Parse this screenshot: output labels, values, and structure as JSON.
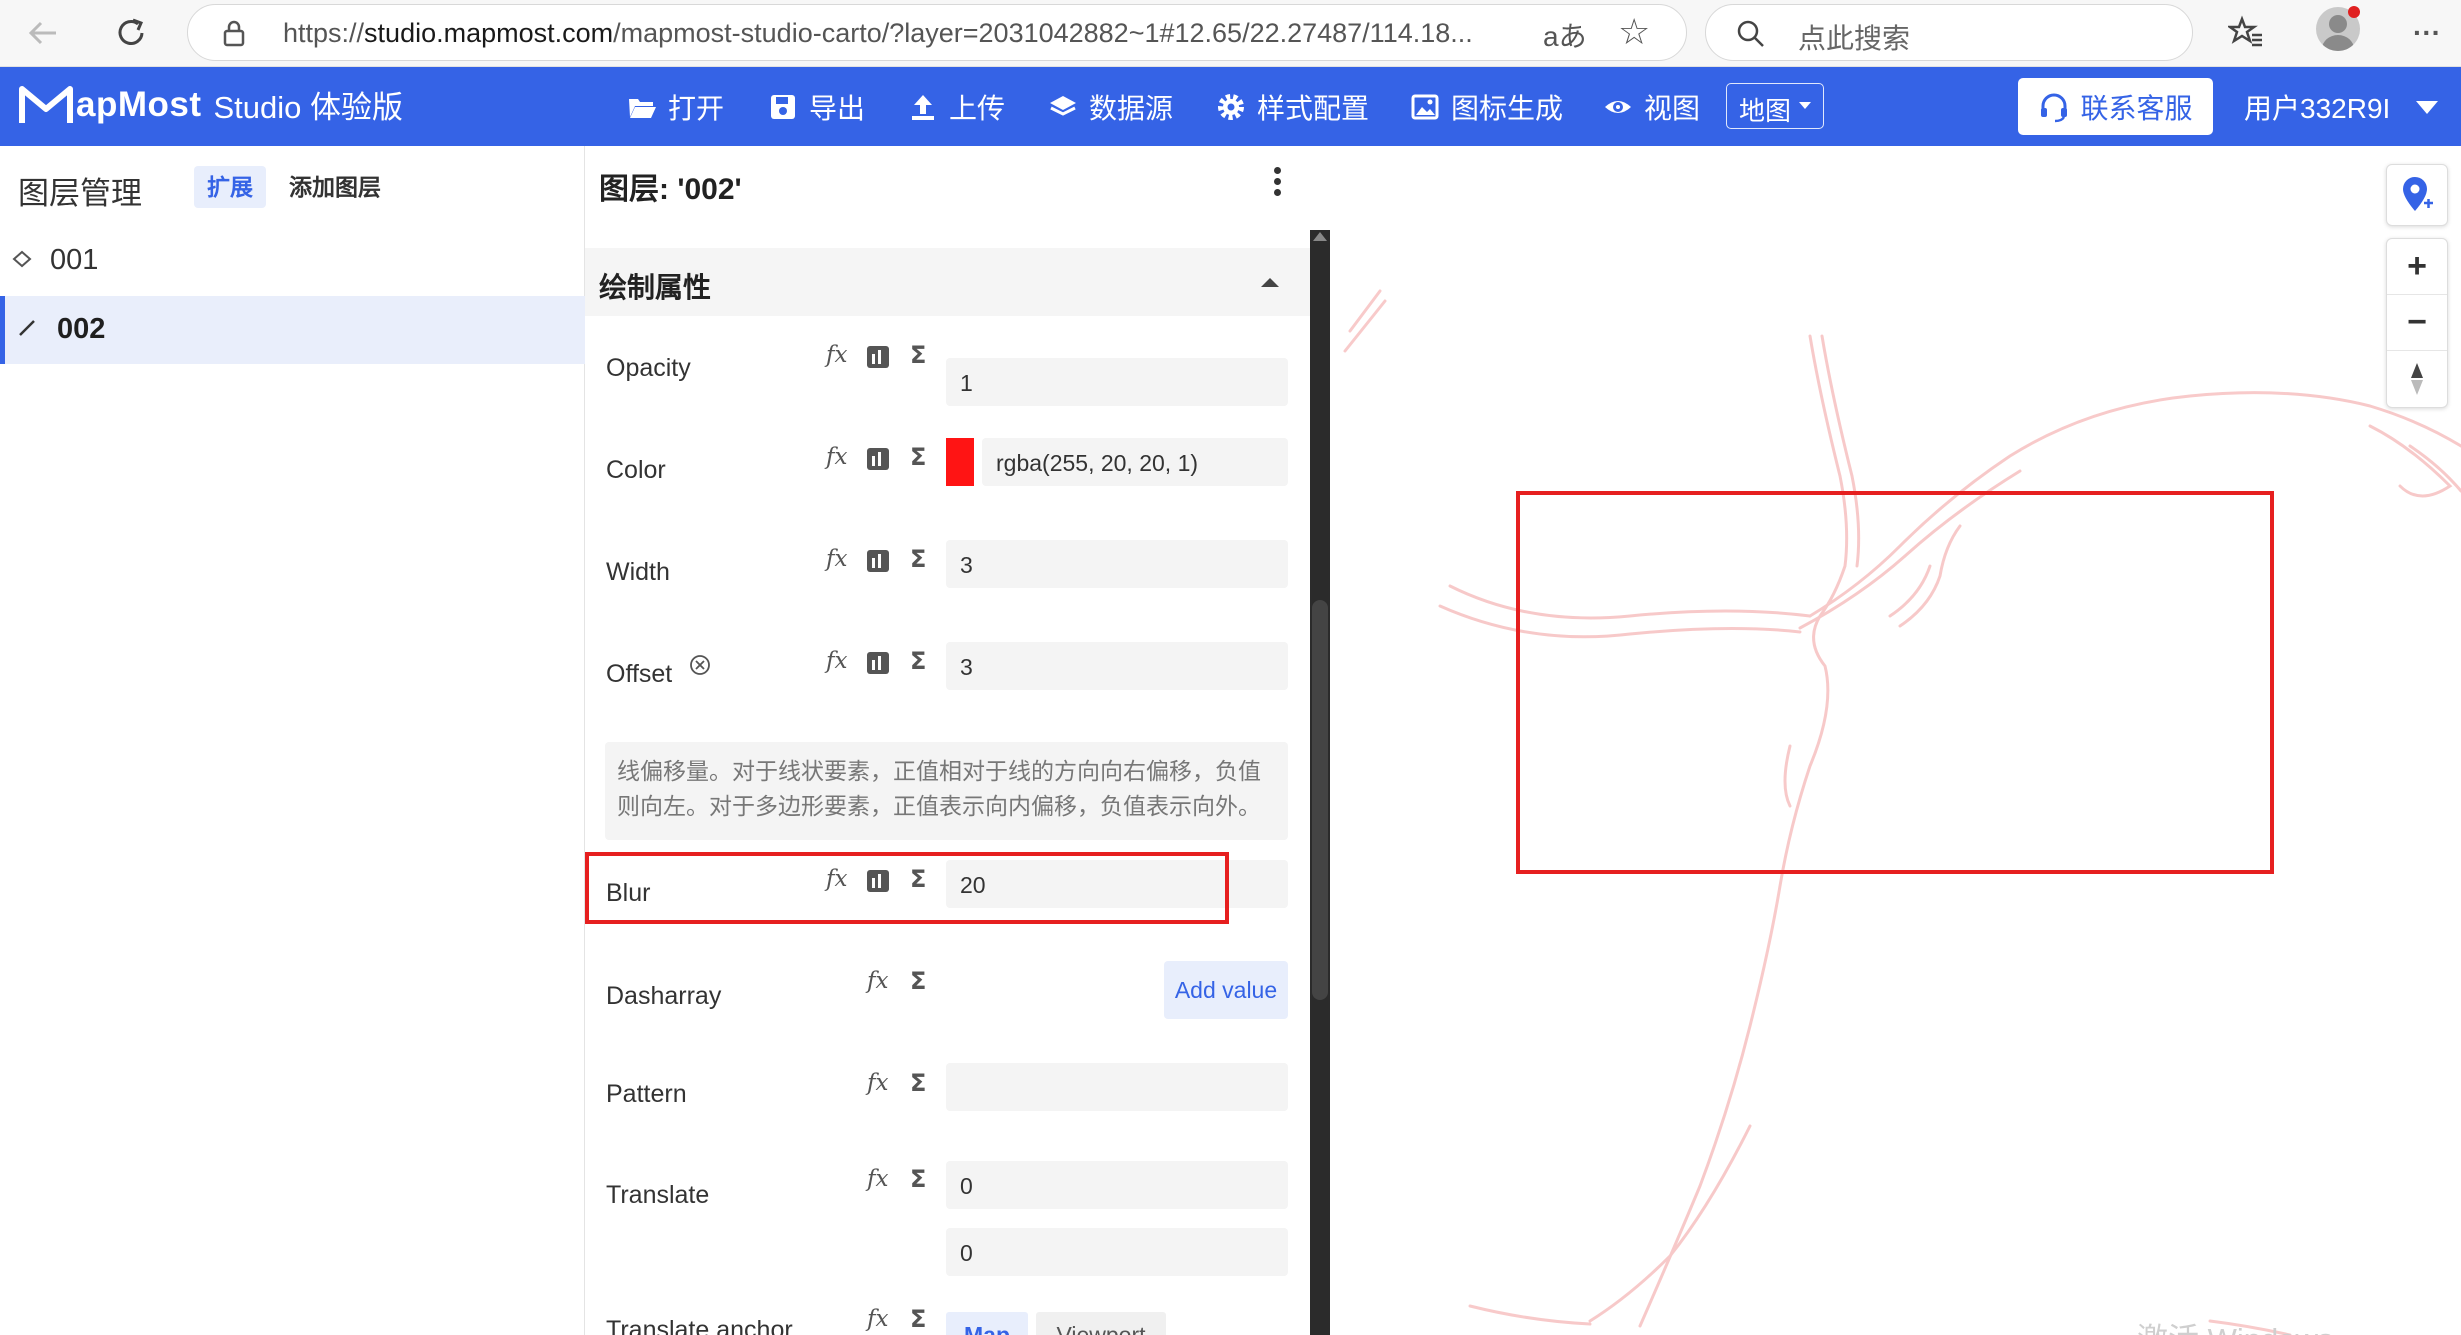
{
  "browser": {
    "url_prefix": "https://",
    "url_host": "studio.mapmost.com",
    "url_path": "/mapmost-studio-carto/?layer=2031042882~1#12.65/22.27487/114.18...",
    "reader_label": "aあ",
    "search_placeholder": "点此搜索"
  },
  "header": {
    "logo_text": "apMost",
    "logo_product": "Studio 体验版",
    "nav": [
      {
        "label": "打开",
        "icon": "folder-open-icon"
      },
      {
        "label": "导出",
        "icon": "save-icon"
      },
      {
        "label": "上传",
        "icon": "upload-icon"
      },
      {
        "label": "数据源",
        "icon": "layers-icon"
      },
      {
        "label": "样式配置",
        "icon": "gear-icon"
      },
      {
        "label": "图标生成",
        "icon": "image-icon"
      },
      {
        "label": "视图",
        "icon": "eye-icon"
      }
    ],
    "view_select": "地图",
    "support_label": "联系客服",
    "user_label": "用户332R9I"
  },
  "layer_panel": {
    "title": "图层管理",
    "expand_label": "扩展",
    "add_layer_label": "添加图层",
    "layers": [
      {
        "name": "001",
        "type": "polygon"
      },
      {
        "name": "002",
        "type": "line",
        "selected": true
      }
    ]
  },
  "properties": {
    "header": "图层: '002'",
    "section_title": "绘制属性",
    "opacity": {
      "label": "Opacity",
      "value": "1"
    },
    "color": {
      "label": "Color",
      "value": "rgba(255, 20, 20, 1)",
      "swatch": "#ff1414"
    },
    "width": {
      "label": "Width",
      "value": "3"
    },
    "offset": {
      "label": "Offset",
      "value": "3",
      "help": "线偏移量。对于线状要素，正值相对于线的方向向右偏移，负值则向左。对于多边形要素，正值表示向内偏移，负值表示向外。"
    },
    "blur": {
      "label": "Blur",
      "value": "20"
    },
    "dasharray": {
      "label": "Dasharray",
      "add_label": "Add value"
    },
    "pattern": {
      "label": "Pattern",
      "value": ""
    },
    "translate": {
      "label": "Translate",
      "x": "0",
      "y": "0"
    },
    "translate_anchor": {
      "label": "Translate anchor",
      "options": [
        "Map",
        "Viewport"
      ],
      "selected": "Map"
    },
    "fx_label": "fx",
    "sigma_label": "Σ"
  },
  "map": {
    "watermark": "激活 Windows",
    "zoom_in": "+",
    "zoom_out": "−",
    "highlight_color": "#e61f1f",
    "line_color": "#f5b8b8"
  }
}
